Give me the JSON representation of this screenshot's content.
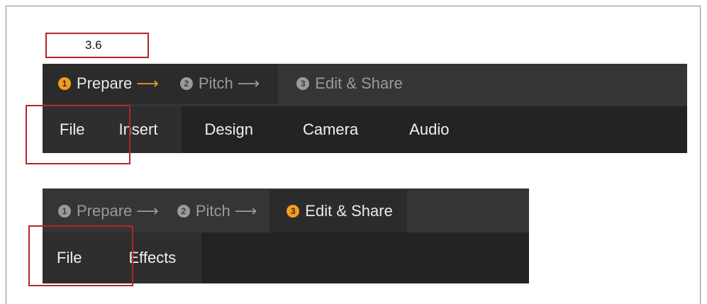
{
  "version_label": "3.6",
  "toolbar_top": {
    "steps": [
      {
        "number": "1",
        "label": "Prepare",
        "arrow": "⟶"
      },
      {
        "number": "2",
        "label": "Pitch",
        "arrow": "⟶"
      },
      {
        "number": "3",
        "label": "Edit & Share",
        "arrow": ""
      }
    ],
    "menu": [
      "File",
      "Insert",
      "Design",
      "Camera",
      "Audio"
    ]
  },
  "toolbar_bottom": {
    "steps": [
      {
        "number": "1",
        "label": "Prepare",
        "arrow": "⟶"
      },
      {
        "number": "2",
        "label": "Pitch",
        "arrow": "⟶"
      },
      {
        "number": "3",
        "label": "Edit & Share",
        "arrow": ""
      }
    ],
    "menu": [
      "File",
      "Effects"
    ]
  },
  "colors": {
    "accent_orange": "#f39b21",
    "highlight_red": "#b3262a",
    "toolbar_dark": "#353535",
    "menu_dark": "#232323"
  }
}
